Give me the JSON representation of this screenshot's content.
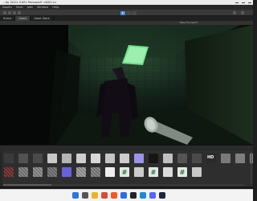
{
  "window": {
    "title": "...ity 2021.3.8f1 Personal* <DX11>"
  },
  "menu": [
    "Assets",
    "Tools",
    "Jobs",
    "Window",
    "Help"
  ],
  "tabs": [
    {
      "label": "Scene",
      "active": false
    },
    {
      "label": "Game",
      "active": true
    },
    {
      "label": "Asset Store",
      "active": false
    }
  ],
  "game_view": {
    "toolbar_text": "Play Focused  ▾"
  },
  "bottom_panel": {
    "assets_row1": [
      {
        "label": "",
        "color": "#3b3b3b"
      },
      {
        "label": "",
        "color": "#525252"
      },
      {
        "label": "",
        "color": "#4a4a4a"
      },
      {
        "label": "",
        "color": "#c9c9c9"
      },
      {
        "label": "",
        "color": "#b5b5b5"
      },
      {
        "label": "",
        "color": "#cfcfcf"
      },
      {
        "label": "",
        "color": "#d8d8d8"
      },
      {
        "label": "",
        "color": "#c5c5c5"
      },
      {
        "label": "",
        "color": "#cccccc"
      },
      {
        "label": "",
        "color": "#9b93e8"
      },
      {
        "label": "",
        "color": "#161616"
      },
      {
        "label": "",
        "color": "#c0c0c0"
      },
      {
        "label": "",
        "color": "#555555"
      },
      {
        "label": "",
        "color": "#4a4a4a"
      },
      {
        "label": "HD",
        "color": "#2a2a2a"
      },
      {
        "label": "",
        "color": "#7a7a7a"
      },
      {
        "label": "",
        "color": "#7e7e7e"
      },
      {
        "label": "",
        "color": "#888888"
      }
    ],
    "assets_row2": [
      {
        "label": "",
        "color": "#6b2a2a",
        "kind": "tex-red"
      },
      {
        "label": "",
        "color": "#7a7a7a",
        "kind": "tex-gray"
      },
      {
        "label": "",
        "color": "#888888",
        "kind": "tex-rust"
      },
      {
        "label": "",
        "color": "#6f6f6f",
        "kind": "tex-noise"
      },
      {
        "label": "",
        "color": "#6863d6",
        "kind": "flat"
      },
      {
        "label": "",
        "color": "#9a9a9a",
        "kind": "tex-gray"
      },
      {
        "label": "",
        "color": "#7d7d7d",
        "kind": "tex-noise"
      },
      {
        "label": "",
        "color": "#eeeeee",
        "kind": "flat"
      },
      {
        "label": "",
        "color": "#e6e6e6",
        "kind": "script"
      },
      {
        "label": "",
        "color": "#cccccc",
        "kind": "flat"
      },
      {
        "label": "",
        "color": "#e6e6e6",
        "kind": "script"
      },
      {
        "label": "",
        "color": "#dcdcdc",
        "kind": "flat"
      },
      {
        "label": "",
        "color": "#e6e6e6",
        "kind": "script"
      },
      {
        "label": "",
        "color": "#c8c8c8",
        "kind": "flat"
      }
    ]
  },
  "taskbar": {
    "icons": [
      {
        "name": "windows-start-icon",
        "color": "#2b78d7"
      },
      {
        "name": "search-icon",
        "color": "#555555"
      },
      {
        "name": "file-explorer-icon",
        "color": "#e8b62c"
      },
      {
        "name": "chrome-icon",
        "color": "#d94b3a"
      },
      {
        "name": "brave-icon",
        "color": "#f05a28"
      },
      {
        "name": "blue-app-icon",
        "color": "#2d6cdf"
      },
      {
        "name": "unity-icon",
        "color": "#222222"
      },
      {
        "name": "vscode-icon",
        "color": "#1f8ad2"
      },
      {
        "name": "discord-icon",
        "color": "#5865f2"
      },
      {
        "name": "steam-icon",
        "color": "#1b2838"
      }
    ]
  },
  "colors": {
    "accent": "#4f8cd9",
    "ceiling_light": "#6fe08a"
  }
}
